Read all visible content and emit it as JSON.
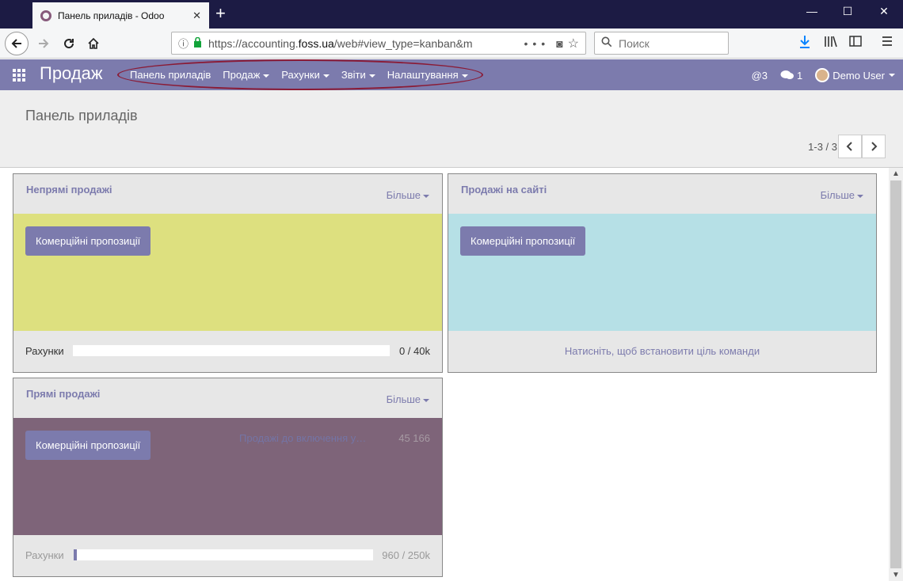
{
  "browser": {
    "tab_title": "Панель приладів - Odoo",
    "tab_close": "✕",
    "new_tab": "+",
    "url_prefix": "https://accounting.",
    "url_domain": "foss.ua",
    "url_rest": "/web#view_type=kanban&m",
    "search_placeholder": "Поиск",
    "window_controls": [
      "—",
      "☐",
      "✕"
    ]
  },
  "navbar": {
    "brand": "Продаж",
    "menu": [
      {
        "label": "Панель приладів",
        "dropdown": false
      },
      {
        "label": "Продаж",
        "dropdown": true
      },
      {
        "label": "Рахунки",
        "dropdown": true
      },
      {
        "label": "Звіти",
        "dropdown": true
      },
      {
        "label": "Налаштування",
        "dropdown": true
      }
    ],
    "mentions": "@3",
    "messages_count": "1",
    "user": "Demo User"
  },
  "control_panel": {
    "breadcrumb": "Панель приладів",
    "pager": "1-3 / 3"
  },
  "cards": [
    {
      "title": "Непрямі продажі",
      "more": "Більше",
      "button": "Комерційні пропозиції",
      "color": "#dde07f",
      "footer_label": "Рахунки",
      "footer_value": "0 / 40k",
      "progress": 0
    },
    {
      "title": "Продажі на сайті",
      "more": "Більше",
      "button": "Комерційні пропозиції",
      "color": "#b6e0e6",
      "footer_text": "Натисніть, щоб встановити ціль команди"
    },
    {
      "title": "Прямі продажі",
      "more": "Більше",
      "button": "Комерційні пропозиції",
      "color": "#7e6479",
      "graph_label": "Продажі до включення у…",
      "graph_value": "45 166",
      "footer_label": "Рахунки",
      "footer_value": "960 / 250k",
      "progress": 0.0038
    }
  ],
  "colors": {
    "navbar": "#7c7bad",
    "tabstrip": "#1c1b44",
    "highlight_ellipse": "#8a1b36"
  }
}
